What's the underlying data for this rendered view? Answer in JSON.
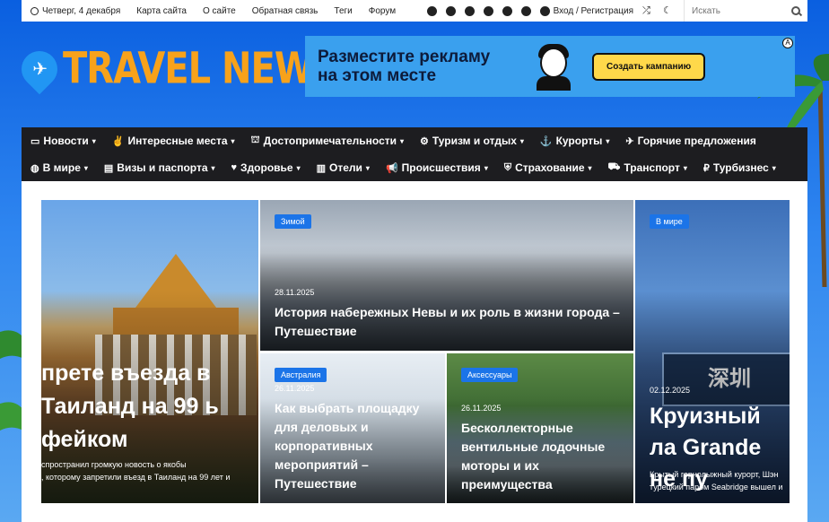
{
  "topbar": {
    "date": "Четверг, 4 декабря",
    "links": [
      "Карта сайта",
      "О сайте",
      "Обратная связь",
      "Теги",
      "Форум"
    ],
    "login": "Вход / Регистрация",
    "search_placeholder": "Искать"
  },
  "logo": {
    "text": "TRAVEL NEWS"
  },
  "banner": {
    "line1": "Разместите рекламу",
    "line2": "на этом месте",
    "button": "Создать кампанию"
  },
  "nav": {
    "row1": [
      {
        "label": "Новости",
        "icon": "▭",
        "caret": "▾"
      },
      {
        "label": "Интересные места",
        "icon": "✌",
        "caret": "▾"
      },
      {
        "label": "Достопримечательности",
        "icon": "⛫",
        "caret": "▾"
      },
      {
        "label": "Туризм и отдых",
        "icon": "⚙",
        "caret": "▾"
      },
      {
        "label": "Курорты",
        "icon": "⚓",
        "caret": "▾"
      },
      {
        "label": "Горячие предложения",
        "icon": "✈",
        "caret": ""
      }
    ],
    "row2": [
      {
        "label": "В мире",
        "icon": "◍",
        "caret": "▾"
      },
      {
        "label": "Визы и паспорта",
        "icon": "▤",
        "caret": "▾"
      },
      {
        "label": "Здоровье",
        "icon": "♥",
        "caret": "▾"
      },
      {
        "label": "Отели",
        "icon": "▥",
        "caret": "▾"
      },
      {
        "label": "Происшествия",
        "icon": "📢",
        "caret": "▾"
      },
      {
        "label": "Страхование",
        "icon": "⛨",
        "caret": "▾"
      },
      {
        "label": "Транспорт",
        "icon": "⛟",
        "caret": "▾"
      },
      {
        "label": "Турбизнес",
        "icon": "₽",
        "caret": "▾"
      }
    ]
  },
  "cards": {
    "c1": {
      "title": "прете въезда в Таиланд на 99 ь фейком",
      "excerpt_l1": "спространил громкую новость о якобы",
      "excerpt_l2": ", которому запретили въезд в Таиланд на 99 лет и"
    },
    "c2": {
      "tag": "Зимой",
      "date": "28.11.2025",
      "title": "История набережных Невы и их роль в жизни города – Путешествие"
    },
    "c3": {
      "tag": "Австралия",
      "date": "26.11.2025",
      "title": "Как выбрать площадку для деловых и корпоративных мероприятий – Путешествие"
    },
    "c4": {
      "tag": "Аксессуары",
      "date": "26.11.2025",
      "title": "Бесколлекторные вентильные лодочные моторы и их преимущества"
    },
    "c5": {
      "tag": "В мире",
      "sign": "深圳",
      "date": "02.12.2025",
      "title": "Круизный ла Grande не пу",
      "excerpt_l1": "Крытый горнолыжный курорт, Шэн",
      "excerpt_l2": "турецкий паром Seabridge вышел и"
    }
  }
}
